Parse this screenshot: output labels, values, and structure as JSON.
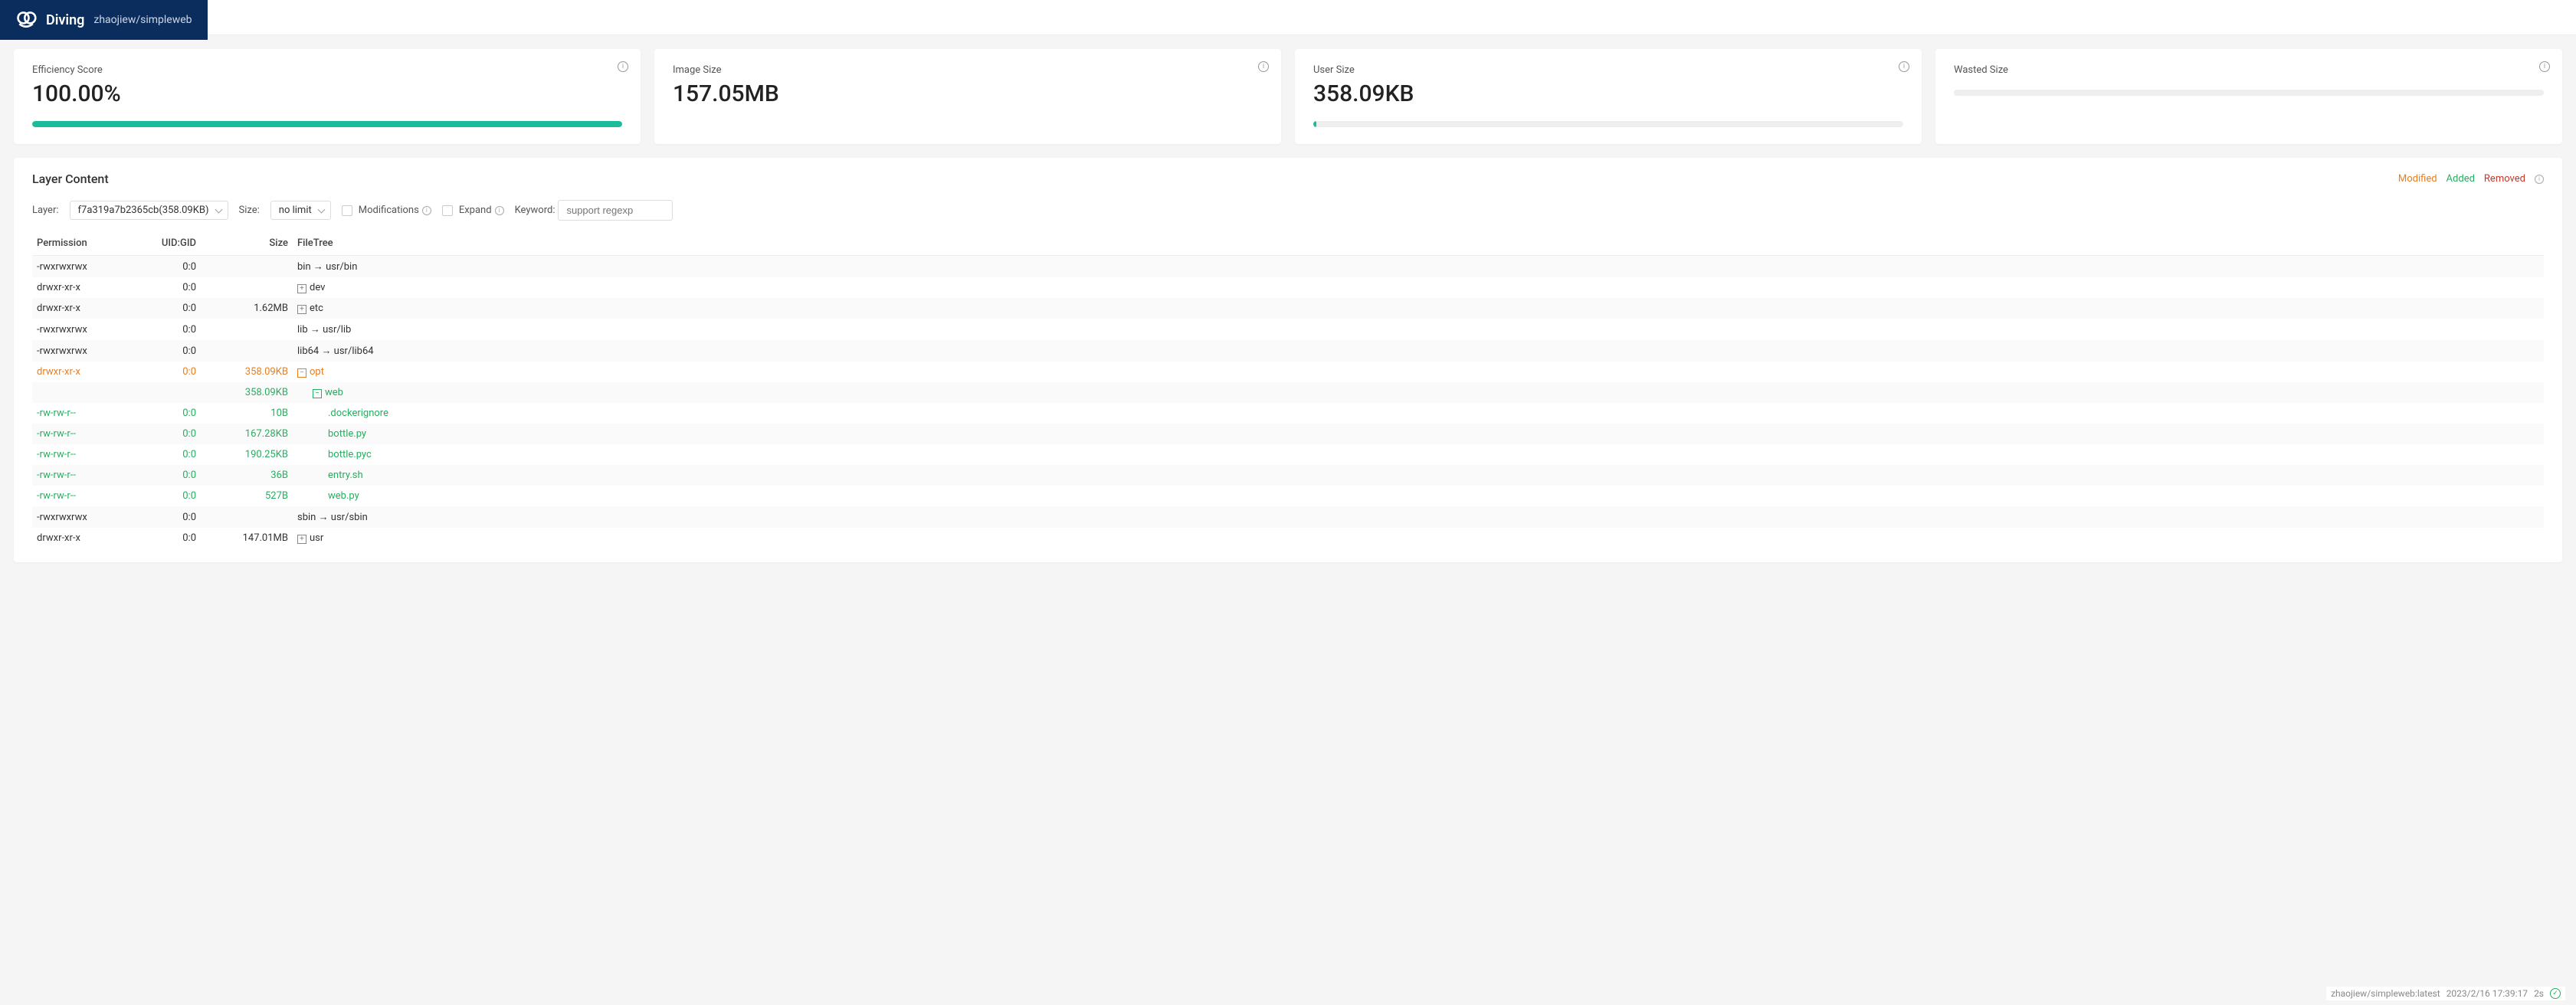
{
  "header": {
    "app_name": "Diving",
    "repo": "zhaojiew/simpleweb"
  },
  "cards": {
    "efficiency": {
      "title": "Efficiency Score",
      "value": "100.00%",
      "progress_pct": 100
    },
    "image_size": {
      "title": "Image Size",
      "value": "157.05MB"
    },
    "user_size": {
      "title": "User Size",
      "value": "358.09KB",
      "progress_pct": 0.5
    },
    "wasted_size": {
      "title": "Wasted Size",
      "value": "",
      "progress_pct": 0
    }
  },
  "panel": {
    "title": "Layer Content",
    "legend": {
      "modified": "Modified",
      "added": "Added",
      "removed": "Removed"
    },
    "controls": {
      "layer_label": "Layer:",
      "layer_selected": "f7a319a7b2365cb(358.09KB)",
      "size_label": "Size:",
      "size_selected": "no limit",
      "modifications_label": "Modifications",
      "expand_label": "Expand",
      "keyword_label": "Keyword:",
      "keyword_placeholder": "support regexp"
    },
    "columns": {
      "permission": "Permission",
      "uidgid": "UID:GID",
      "size": "Size",
      "filetree": "FileTree"
    },
    "rows": [
      {
        "perm": "-rwxrwxrwx",
        "uid": "0:0",
        "size": "",
        "indent": 0,
        "icon": "",
        "name": "bin → usr/bin",
        "state": ""
      },
      {
        "perm": "drwxr-xr-x",
        "uid": "0:0",
        "size": "",
        "indent": 0,
        "icon": "plus",
        "name": "dev",
        "state": ""
      },
      {
        "perm": "drwxr-xr-x",
        "uid": "0:0",
        "size": "1.62MB",
        "indent": 0,
        "icon": "plus",
        "name": "etc",
        "state": ""
      },
      {
        "perm": "-rwxrwxrwx",
        "uid": "0:0",
        "size": "",
        "indent": 0,
        "icon": "",
        "name": "lib → usr/lib",
        "state": ""
      },
      {
        "perm": "-rwxrwxrwx",
        "uid": "0:0",
        "size": "",
        "indent": 0,
        "icon": "",
        "name": "lib64 → usr/lib64",
        "state": ""
      },
      {
        "perm": "drwxr-xr-x",
        "uid": "0:0",
        "size": "358.09KB",
        "indent": 0,
        "icon": "minus",
        "name": "opt",
        "state": "modified"
      },
      {
        "perm": "",
        "uid": "",
        "size": "358.09KB",
        "indent": 1,
        "icon": "minus",
        "name": "web",
        "state": "added"
      },
      {
        "perm": "-rw-rw-r--",
        "uid": "0:0",
        "size": "10B",
        "indent": 2,
        "icon": "",
        "name": ".dockerignore",
        "state": "added"
      },
      {
        "perm": "-rw-rw-r--",
        "uid": "0:0",
        "size": "167.28KB",
        "indent": 2,
        "icon": "",
        "name": "bottle.py",
        "state": "added"
      },
      {
        "perm": "-rw-rw-r--",
        "uid": "0:0",
        "size": "190.25KB",
        "indent": 2,
        "icon": "",
        "name": "bottle.pyc",
        "state": "added"
      },
      {
        "perm": "-rw-rw-r--",
        "uid": "0:0",
        "size": "36B",
        "indent": 2,
        "icon": "",
        "name": "entry.sh",
        "state": "added"
      },
      {
        "perm": "-rw-rw-r--",
        "uid": "0:0",
        "size": "527B",
        "indent": 2,
        "icon": "",
        "name": "web.py",
        "state": "added"
      },
      {
        "perm": "-rwxrwxrwx",
        "uid": "0:0",
        "size": "",
        "indent": 0,
        "icon": "",
        "name": "sbin → usr/sbin",
        "state": ""
      },
      {
        "perm": "drwxr-xr-x",
        "uid": "0:0",
        "size": "147.01MB",
        "indent": 0,
        "icon": "plus",
        "name": "usr",
        "state": ""
      }
    ]
  },
  "status": {
    "image_ref": "zhaojiew/simpleweb:latest",
    "timestamp": "2023/2/16 17:39:17",
    "elapsed": "2s"
  }
}
